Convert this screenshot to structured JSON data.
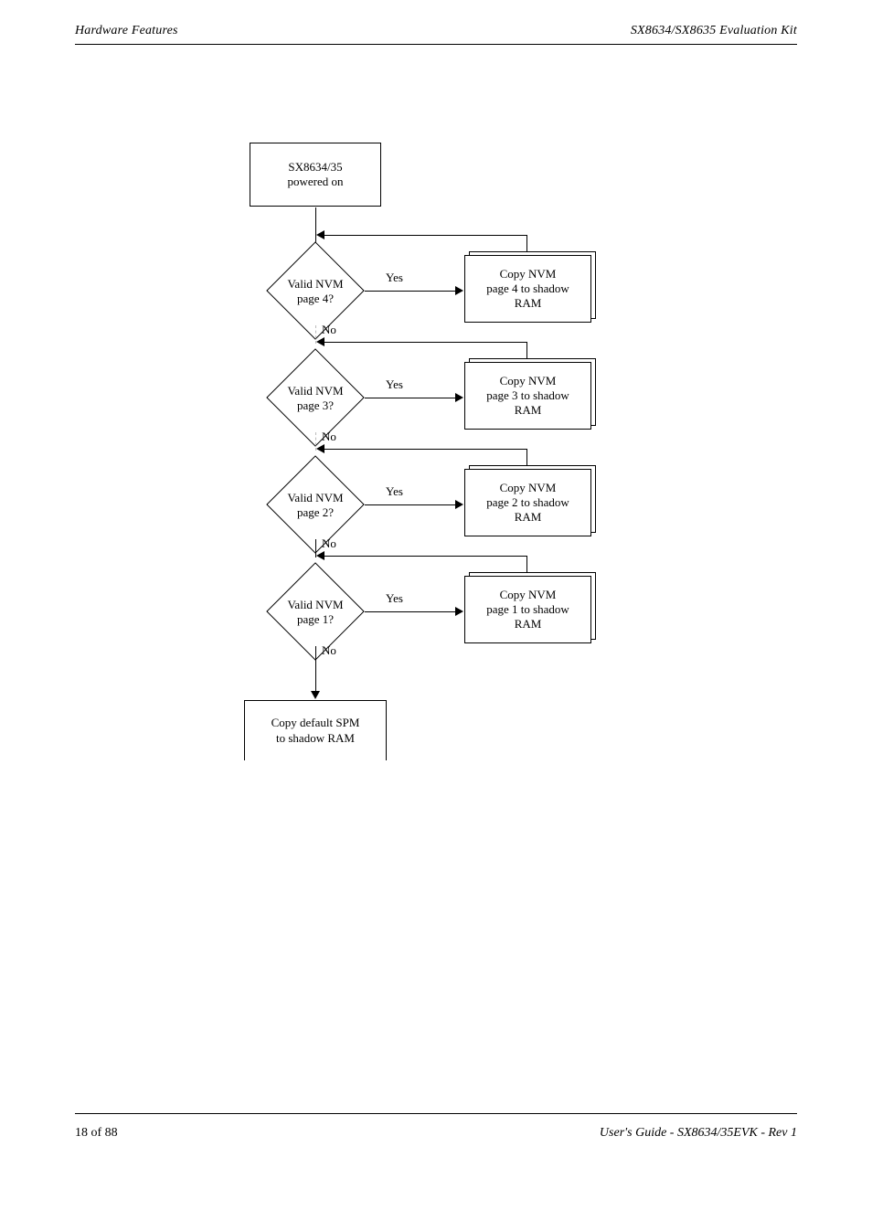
{
  "header": {
    "left": "Hardware Features",
    "right": "SX8634/SX8635 Evaluation Kit"
  },
  "footer": {
    "left": "18 of 88",
    "right": "User's Guide - SX8634/35EVK - Rev 1"
  },
  "diagram": {
    "power_on": "SX8634/35\npowered on",
    "steps": [
      {
        "question": "Valid NVM\npage 4?",
        "yes": "Yes",
        "no": "No",
        "action": "Copy NVM\npage 4 to shadow\nRAM"
      },
      {
        "question": "Valid NVM\npage 3?",
        "yes": "Yes",
        "no": "No",
        "action": "Copy NVM\npage 3 to shadow\nRAM"
      },
      {
        "question": "Valid NVM\npage 2?",
        "yes": "Yes",
        "no": "No",
        "action": "Copy NVM\npage 2 to shadow\nRAM"
      },
      {
        "question": "Valid NVM\npage 1?",
        "yes": "Yes",
        "no": "No",
        "action": "Copy NVM\npage 1 to shadow\nRAM"
      }
    ],
    "end": "Copy default SPM\nto shadow RAM"
  }
}
